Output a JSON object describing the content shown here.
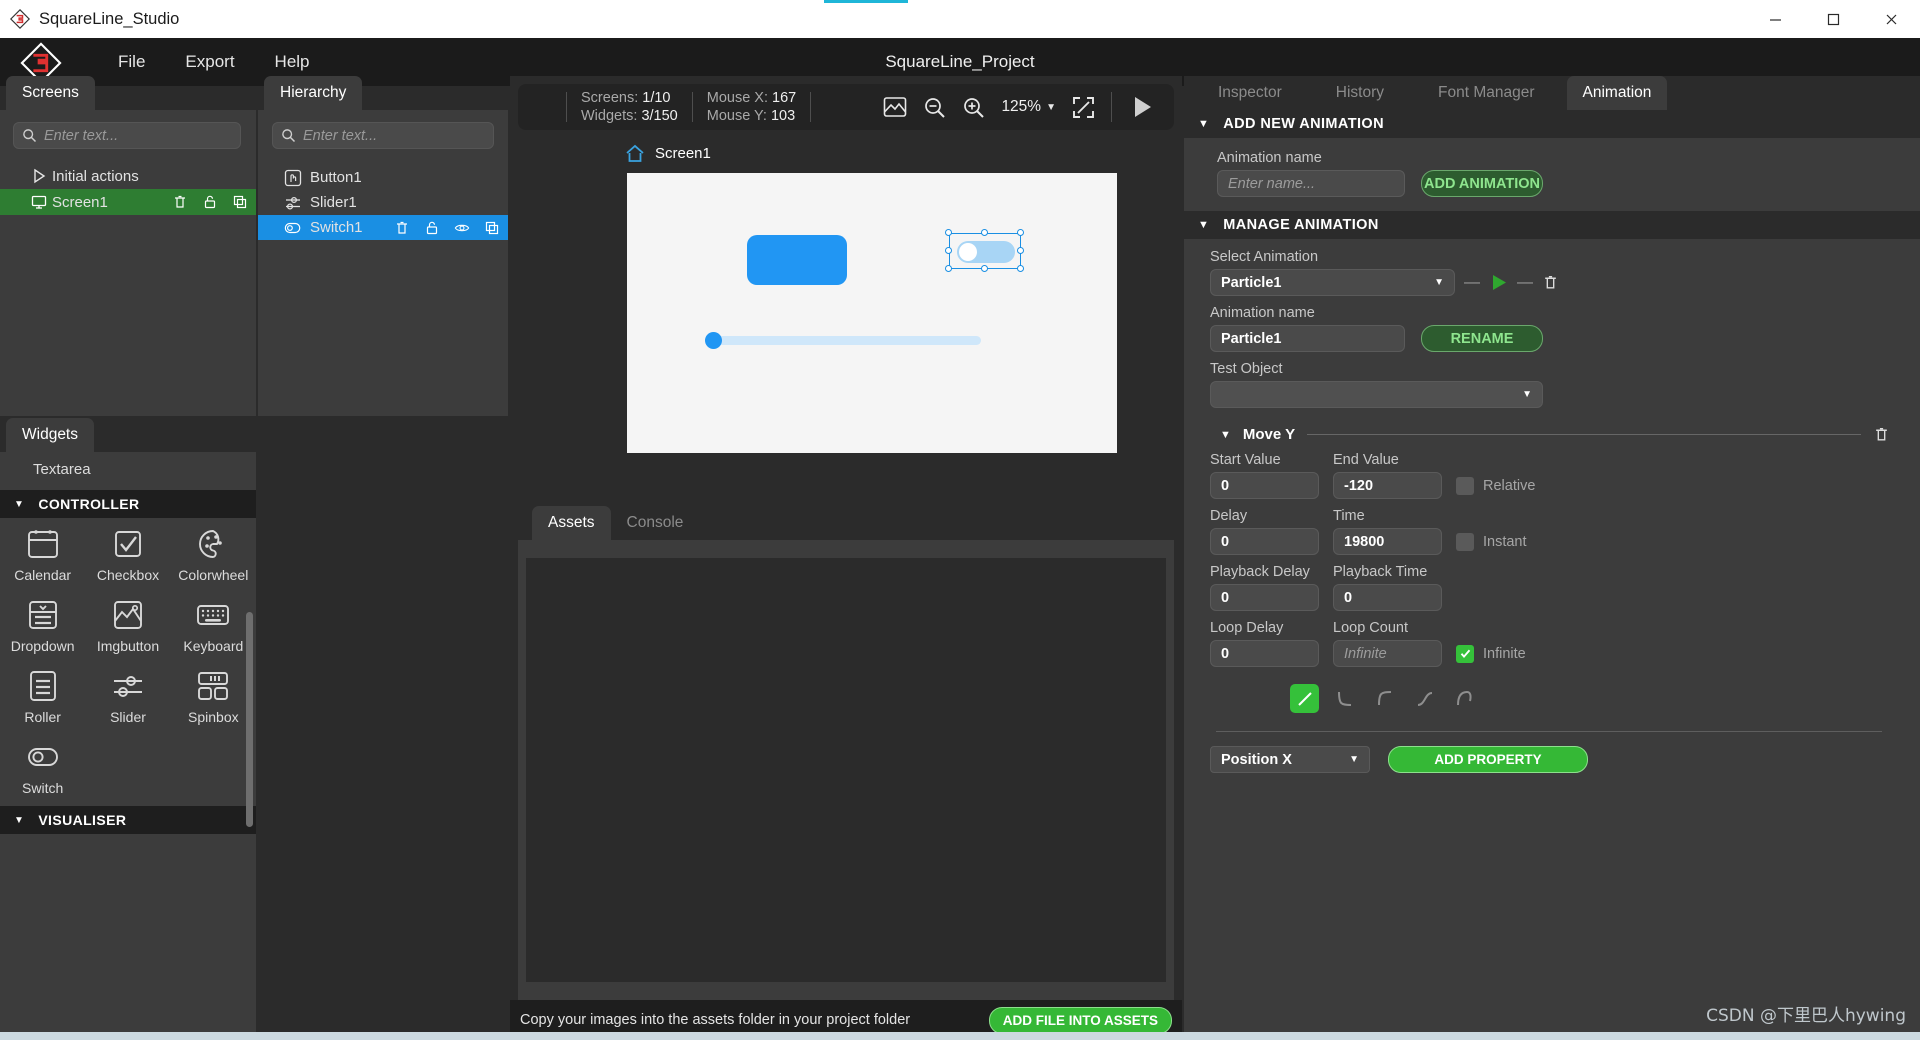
{
  "window": {
    "title": "SquareLine_Studio",
    "controls": {
      "minimize": "minimize-icon",
      "maximize": "maximize-icon",
      "close": "close-icon"
    }
  },
  "menubar": {
    "project_title": "SquareLine_Project",
    "items": [
      {
        "label": "File"
      },
      {
        "label": "Export"
      },
      {
        "label": "Help"
      }
    ]
  },
  "screens_panel": {
    "tab": "Screens",
    "search_placeholder": "Enter text...",
    "rows": [
      {
        "label": "Initial actions",
        "icon": "play-triangle-icon",
        "selected": false
      },
      {
        "label": "Screen1",
        "icon": "monitor-icon",
        "selected": true,
        "actions": [
          "trash-icon",
          "unlock-icon",
          "duplicate-icon"
        ]
      }
    ]
  },
  "hierarchy_panel": {
    "tab": "Hierarchy",
    "search_placeholder": "Enter text...",
    "rows": [
      {
        "label": "Button1",
        "icon": "button-icon",
        "selected": false
      },
      {
        "label": "Slider1",
        "icon": "slider-icon",
        "selected": false
      },
      {
        "label": "Switch1",
        "icon": "switch-icon",
        "selected": true,
        "actions": [
          "trash-icon",
          "unlock-icon",
          "eye-icon",
          "duplicate-icon"
        ]
      }
    ]
  },
  "widgets_panel": {
    "tab": "Widgets",
    "partial_top_item": "Textarea",
    "categories": [
      {
        "name": "CONTROLLER",
        "items": [
          {
            "label": "Calendar",
            "icon": "calendar-icon"
          },
          {
            "label": "Checkbox",
            "icon": "checkbox-icon"
          },
          {
            "label": "Colorwheel",
            "icon": "palette-icon"
          },
          {
            "label": "Dropdown",
            "icon": "dropdown-icon"
          },
          {
            "label": "Imgbutton",
            "icon": "imgbutton-icon"
          },
          {
            "label": "Keyboard",
            "icon": "keyboard-icon"
          },
          {
            "label": "Roller",
            "icon": "roller-icon"
          },
          {
            "label": "Slider",
            "icon": "slider-icon"
          },
          {
            "label": "Spinbox",
            "icon": "spinbox-icon"
          },
          {
            "label": "Switch",
            "icon": "switch-icon"
          }
        ]
      },
      {
        "name": "VISUALISER",
        "items": []
      }
    ]
  },
  "canvas": {
    "toolbar": {
      "screens_label": "Screens:",
      "screens_value": "1/10",
      "widgets_label": "Widgets:",
      "widgets_value": "3/150",
      "mouse_x_label": "Mouse X:",
      "mouse_x_value": "167",
      "mouse_y_label": "Mouse Y:",
      "mouse_y_value": "103",
      "zoom_level": "125%",
      "icons": [
        "image-icon",
        "zoom-out-icon",
        "zoom-in-icon",
        "fit-screen-icon",
        "play-icon"
      ]
    },
    "screen_tag": "Screen1",
    "widgets": [
      {
        "name": "Button1",
        "type": "button",
        "color": "#2196f3"
      },
      {
        "name": "Switch1",
        "type": "switch",
        "selected": true,
        "track_color": "#a8d5f5"
      },
      {
        "name": "Slider1",
        "type": "slider",
        "track_color": "#cfe7fa",
        "knob_color": "#2196f3"
      }
    ]
  },
  "assets_panel": {
    "tabs": [
      {
        "label": "Assets",
        "active": true
      },
      {
        "label": "Console",
        "active": false
      }
    ],
    "footer_message": "Copy your images into the assets folder in your project folder",
    "footer_button": "ADD FILE INTO ASSETS"
  },
  "right_panel": {
    "tabs": [
      {
        "label": "Inspector",
        "active": false
      },
      {
        "label": "History",
        "active": false
      },
      {
        "label": "Font Manager",
        "active": false
      },
      {
        "label": "Animation",
        "active": true
      }
    ],
    "add_new_animation": {
      "section_title": "ADD NEW ANIMATION",
      "name_label": "Animation name",
      "name_placeholder": "Enter name...",
      "name_value": "",
      "add_button": "ADD ANIMATION"
    },
    "manage_animation": {
      "section_title": "MANAGE ANIMATION",
      "select_label": "Select Animation",
      "select_value": "Particle1",
      "name_label": "Animation name",
      "name_value": "Particle1",
      "rename_button": "RENAME",
      "test_object_label": "Test Object",
      "test_object_value": "",
      "property": {
        "title": "Move Y",
        "fields": [
          {
            "label": "Start Value",
            "value": "0"
          },
          {
            "label": "End Value",
            "value": "-120"
          },
          {
            "label": "Delay",
            "value": "0"
          },
          {
            "label": "Time",
            "value": "19800"
          },
          {
            "label": "Playback Delay",
            "value": "0"
          },
          {
            "label": "Playback Time",
            "value": "0"
          },
          {
            "label": "Loop Delay",
            "value": "0"
          },
          {
            "label": "Loop Count",
            "value": "Infinite",
            "placeholder": true
          }
        ],
        "checkboxes": [
          {
            "label": "Relative",
            "checked": false
          },
          {
            "label": "Instant",
            "checked": false
          },
          {
            "label": "Infinite",
            "checked": true
          }
        ],
        "easing_selected_index": 0
      },
      "add_property_select": "Position X",
      "add_property_button": "ADD PROPERTY"
    }
  },
  "watermark": "CSDN @下里巴人hywing",
  "colors": {
    "accent_blue": "#1a8fe3",
    "green": "#35c13a",
    "selection_green": "#2e7d32",
    "panel_bg": "#3c3c3c",
    "dark_bg": "#2b2b2b",
    "darkest": "#1e1e1e"
  }
}
